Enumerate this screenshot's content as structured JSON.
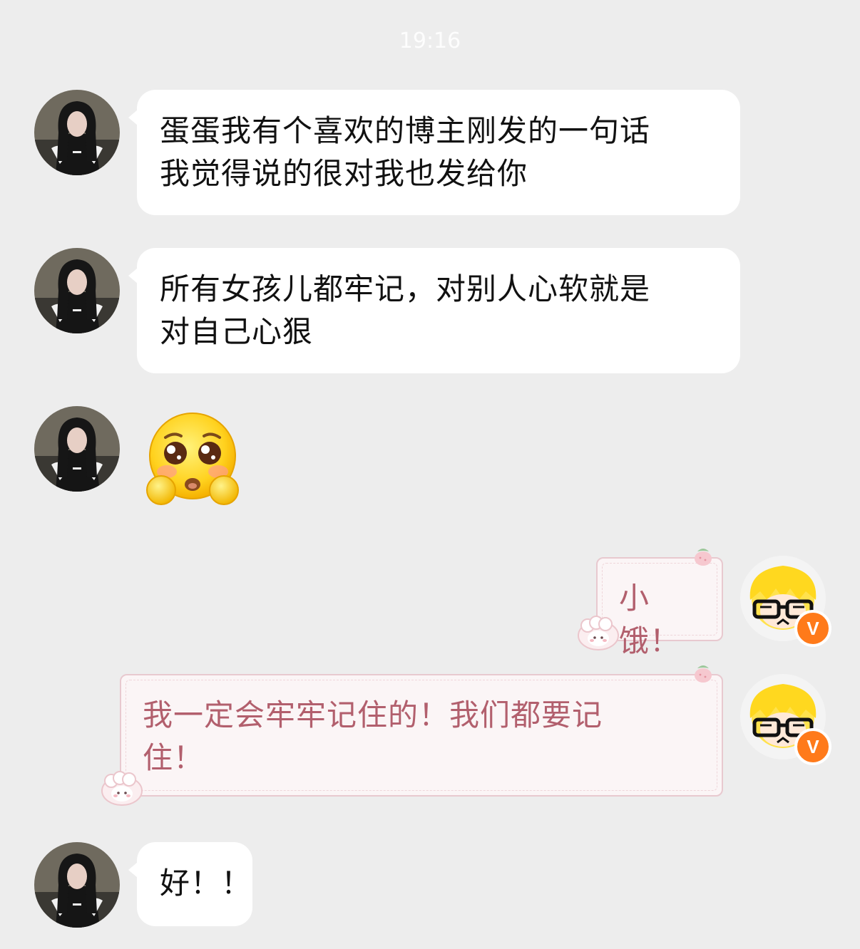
{
  "header": {
    "timestamp": "19:16"
  },
  "messages": [
    {
      "sender": "other",
      "text_line1": "蛋蛋我有个喜欢的博主刚发的一句话",
      "text_line2": "我觉得说的很对我也发给你"
    },
    {
      "sender": "other",
      "text_line1": "所有女孩儿都牢记，对别人心软就是",
      "text_line2": "对自己心狠"
    },
    {
      "sender": "other",
      "emoji": "pleading-face-emoji"
    },
    {
      "sender": "me",
      "text": "小饿！"
    },
    {
      "sender": "me",
      "text_line1": "我一定会牢牢记住的！我们都要记",
      "text_line2": "住！"
    },
    {
      "sender": "other",
      "text": "好！！"
    }
  ],
  "me": {
    "badge": "V",
    "badge_color": "#ff7a1a",
    "bubble_text_color": "#b25f6d"
  },
  "colors": {
    "background": "#ededed",
    "bubble": "#ffffff",
    "text": "#111111"
  }
}
